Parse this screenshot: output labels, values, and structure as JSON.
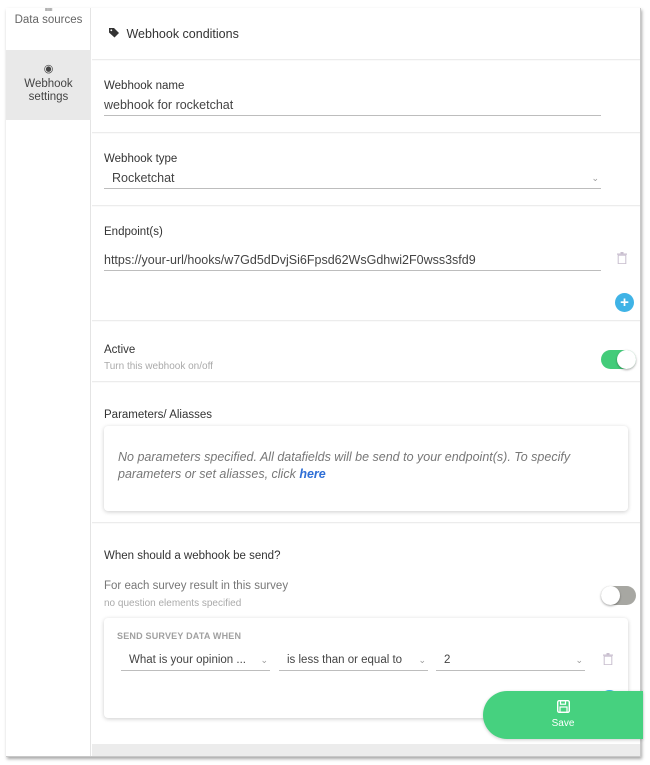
{
  "sidebar": {
    "items": [
      {
        "label": "Data sources",
        "icon": "table-grid-icon",
        "glyph": "▦",
        "active": false
      },
      {
        "label": "Webhook\nsettings",
        "line1": "Webhook",
        "line2": "settings",
        "icon": "radio-target-icon",
        "glyph": "◉",
        "active": true
      }
    ]
  },
  "header": {
    "title": "Webhook conditions",
    "icon": "tag-icon",
    "glyph": "🏷"
  },
  "webhook_name": {
    "label": "Webhook name",
    "value": "webhook for rocketchat"
  },
  "webhook_type": {
    "label": "Webhook type",
    "value": "Rocketchat",
    "chevron": "⌄"
  },
  "endpoints": {
    "label": "Endpoint(s)",
    "items": [
      {
        "value": "https://your-url/hooks/w7Gd5dDvjSi6Fpsd62WsGdhwi2F0wss3sfd9"
      }
    ],
    "delete_glyph": "🗑",
    "add_glyph": "+"
  },
  "active": {
    "label": "Active",
    "sublabel": "Turn this webhook on/off",
    "on": true
  },
  "parameters": {
    "label": "Parameters/ Aliasses",
    "text": "No parameters specified. All datafields will be send to your endpoint(s). To specify parameters or set aliasses, click ",
    "link": "here"
  },
  "when": {
    "label": "When should a webhook be send?",
    "each_result_label": "For each survey result in this survey",
    "each_result_sub": "no question elements specified",
    "each_result_on": false,
    "conditions_title": "SEND SURVEY DATA WHEN",
    "condition": {
      "question": "What is your opinion ...",
      "operator": "is less than or equal to",
      "value": "2"
    }
  },
  "colors": {
    "accent_green": "#46d17f",
    "accent_blue": "#3fb3e6",
    "link": "#2f6fd6"
  },
  "save": {
    "label": "Save",
    "glyph": "💾"
  }
}
